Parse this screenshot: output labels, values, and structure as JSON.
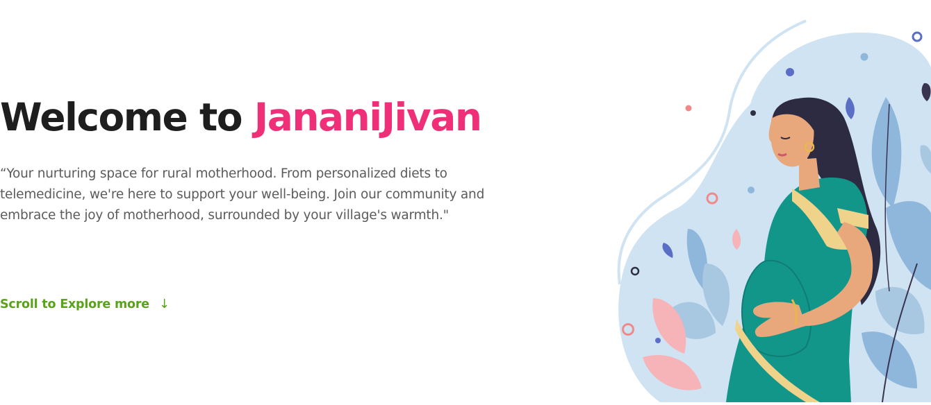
{
  "hero": {
    "title_prefix": "Welcome to ",
    "title_brand": "JananiJivan",
    "tagline": "“Your nurturing space for rural motherhood. From personalized diets to telemedicine, we're here to support your well-being. Join our community and embrace the joy of motherhood, surrounded by your village's warmth.\"",
    "explore_label": "Scroll to Explore more",
    "explore_icon": "arrow-down-icon"
  },
  "colors": {
    "brand": "#ef2f78",
    "heading": "#1e1e1e",
    "body_text": "#5b5b5b",
    "accent_green": "#5aa21b",
    "saree": "#13968a",
    "blob": "#cfe3f3"
  },
  "illustration": {
    "icon": "pregnant-woman-illustration"
  }
}
